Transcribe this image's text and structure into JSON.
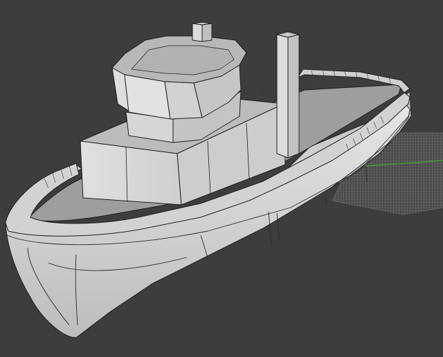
{
  "viewport": {
    "background": "#3d3d3d",
    "model_fill": "#d8d8d8",
    "model_edge": "#1e1e1e",
    "grid_color": "#8a8a8a",
    "axis_y_color": "#4a9a3a"
  },
  "scene": {
    "object": "boat-model",
    "view": "perspective",
    "shading": "solid-with-wireframe",
    "floor_grid_visible": true
  }
}
